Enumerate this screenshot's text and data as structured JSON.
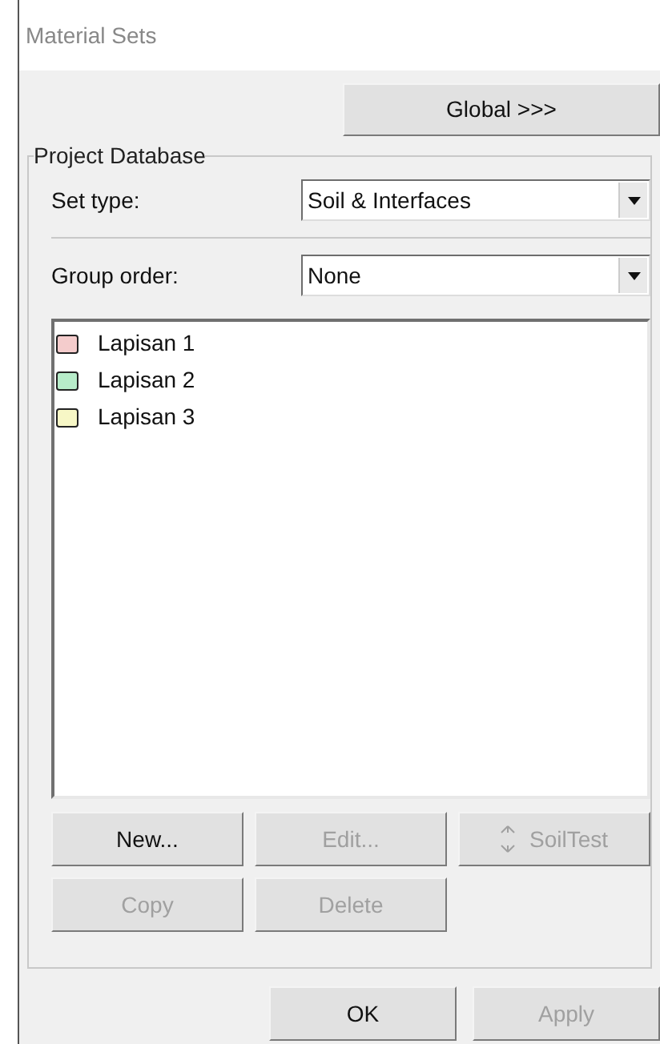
{
  "window": {
    "title": "Material Sets"
  },
  "global_button": {
    "label": "Global >>>",
    "disabled": false
  },
  "group": {
    "title": "Project Database",
    "fields": [
      {
        "label": "Set type:",
        "value": "Soil & Interfaces"
      },
      {
        "label": "Group order:",
        "value": "None"
      }
    ],
    "items": [
      {
        "label": "Lapisan 1",
        "color": "#f4cccc"
      },
      {
        "label": "Lapisan 2",
        "color": "#b7ecc9"
      },
      {
        "label": "Lapisan 3",
        "color": "#f7f7c6"
      }
    ],
    "buttons": [
      {
        "label": "New...",
        "disabled": false,
        "kind": "plain"
      },
      {
        "label": "Edit...",
        "disabled": true,
        "kind": "plain"
      },
      {
        "label": "SoilTest",
        "disabled": true,
        "kind": "icon"
      },
      {
        "label": "Copy",
        "disabled": true,
        "kind": "plain"
      },
      {
        "label": "Delete",
        "disabled": true,
        "kind": "plain"
      }
    ]
  },
  "footer_buttons": [
    {
      "label": "OK",
      "disabled": false
    },
    {
      "label": "Apply",
      "disabled": true
    }
  ]
}
